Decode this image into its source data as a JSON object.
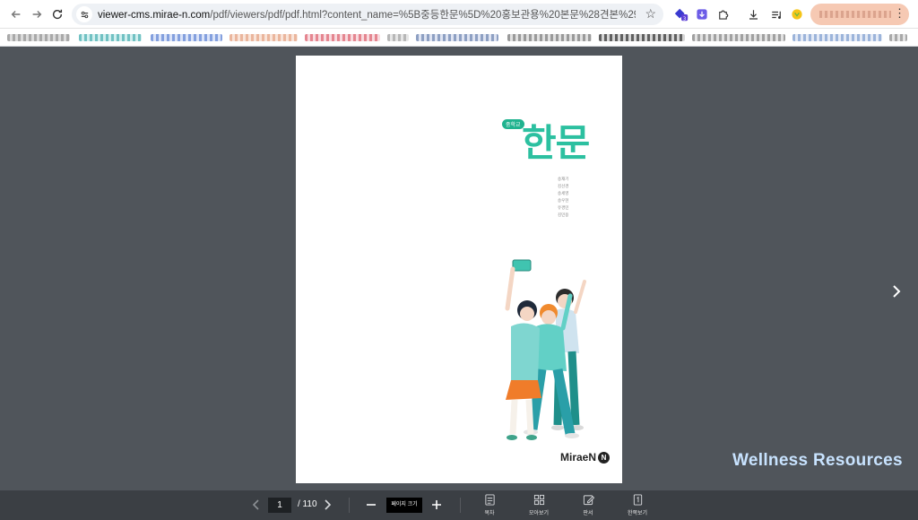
{
  "browser": {
    "url_host": "viewer-cms.mirae-n.com",
    "url_rest": "/pdf/viewers/pdf/pdf.html?content_name=%5B중등한문%5D%20홍보관용%20본문%28견본%29%20PDF&file=https:/..."
  },
  "cover": {
    "badge": "중학교",
    "title": "한문",
    "authors": [
      "송재기",
      "김선경",
      "송세영",
      "송우현",
      "유경민",
      "김민용"
    ],
    "publisher": "MiraeN",
    "publisher_mark": "N"
  },
  "watermark": "Wellness Resources",
  "toolbar": {
    "current_page": "1",
    "total_pages": "/ 110",
    "zoom_label": "페이지 크기",
    "tools": [
      {
        "label": "목차",
        "icon": "toc-icon"
      },
      {
        "label": "모아보기",
        "icon": "grid-icon"
      },
      {
        "label": "판서",
        "icon": "pen-icon"
      },
      {
        "label": "한쪽보기",
        "icon": "single-page-icon"
      }
    ]
  },
  "colors": {
    "viewer_bg": "#50555b",
    "toolbar_bg": "#3b3f44",
    "title_teal": "#2cc0a0",
    "watermark": "#c8e3ff"
  }
}
